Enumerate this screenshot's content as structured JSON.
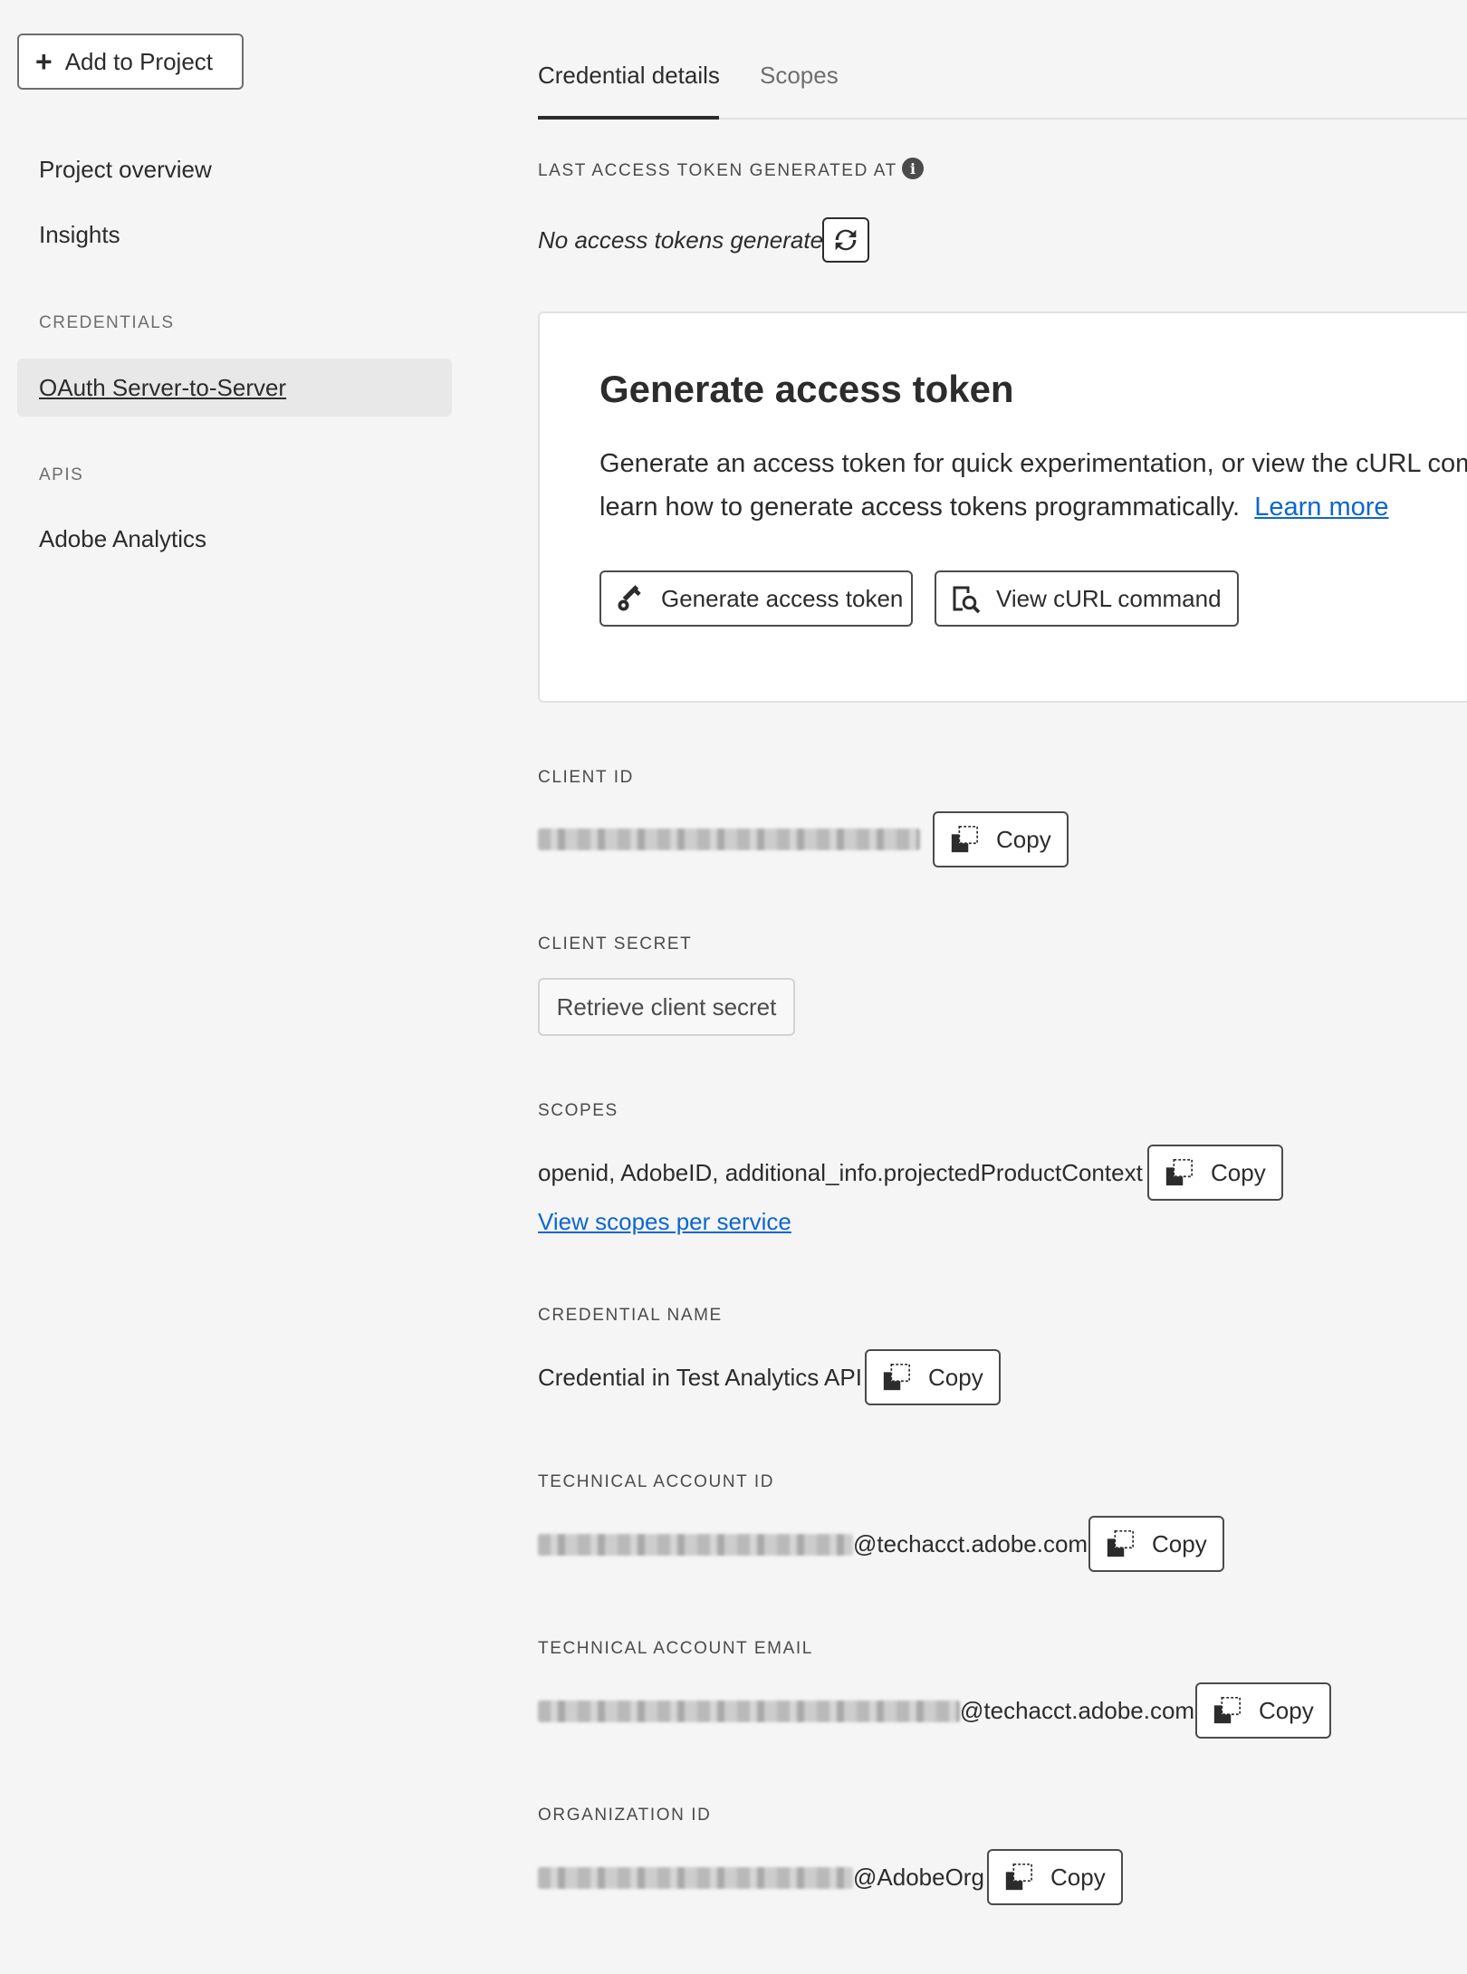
{
  "sidebar": {
    "add_button": "Add to Project",
    "items": [
      {
        "label": "Project overview"
      },
      {
        "label": "Insights"
      }
    ],
    "credentials_heading": "CREDENTIALS",
    "credential_item": "OAuth Server-to-Server",
    "apis_heading": "APIS",
    "api_item": "Adobe Analytics"
  },
  "tabs": [
    {
      "label": "Credential details",
      "active": true
    },
    {
      "label": "Scopes",
      "active": false
    }
  ],
  "token": {
    "label": "LAST ACCESS TOKEN GENERATED AT",
    "status": "No access tokens generated"
  },
  "card": {
    "title": "Generate access token",
    "desc_line1": "Generate an access token for quick experimentation, or view the cURL com",
    "desc_line2": "learn how to generate access tokens programmatically.",
    "learn_more": "Learn more",
    "generate_button": "Generate access token",
    "curl_button": "View cURL command"
  },
  "copy_label": "Copy",
  "fields": {
    "client_id": {
      "label": "CLIENT ID"
    },
    "client_secret": {
      "label": "CLIENT SECRET",
      "button": "Retrieve client secret"
    },
    "scopes": {
      "label": "SCOPES",
      "value": "openid, AdobeID, additional_info.projectedProductContext",
      "link": "View scopes per service"
    },
    "credential_name": {
      "label": "CREDENTIAL NAME",
      "value": "Credential in Test Analytics API"
    },
    "technical_account_id": {
      "label": "TECHNICAL ACCOUNT ID",
      "suffix": "@techacct.adobe.com"
    },
    "technical_account_email": {
      "label": "TECHNICAL ACCOUNT EMAIL",
      "suffix": "@techacct.adobe.com"
    },
    "organization_id": {
      "label": "ORGANIZATION ID",
      "suffix": "@AdobeOrg"
    }
  },
  "icons": {
    "plus": "plus-icon",
    "info": "info-icon",
    "refresh": "refresh-icon",
    "key": "key-icon",
    "search_doc": "search-document-icon",
    "copy": "copy-icon"
  }
}
